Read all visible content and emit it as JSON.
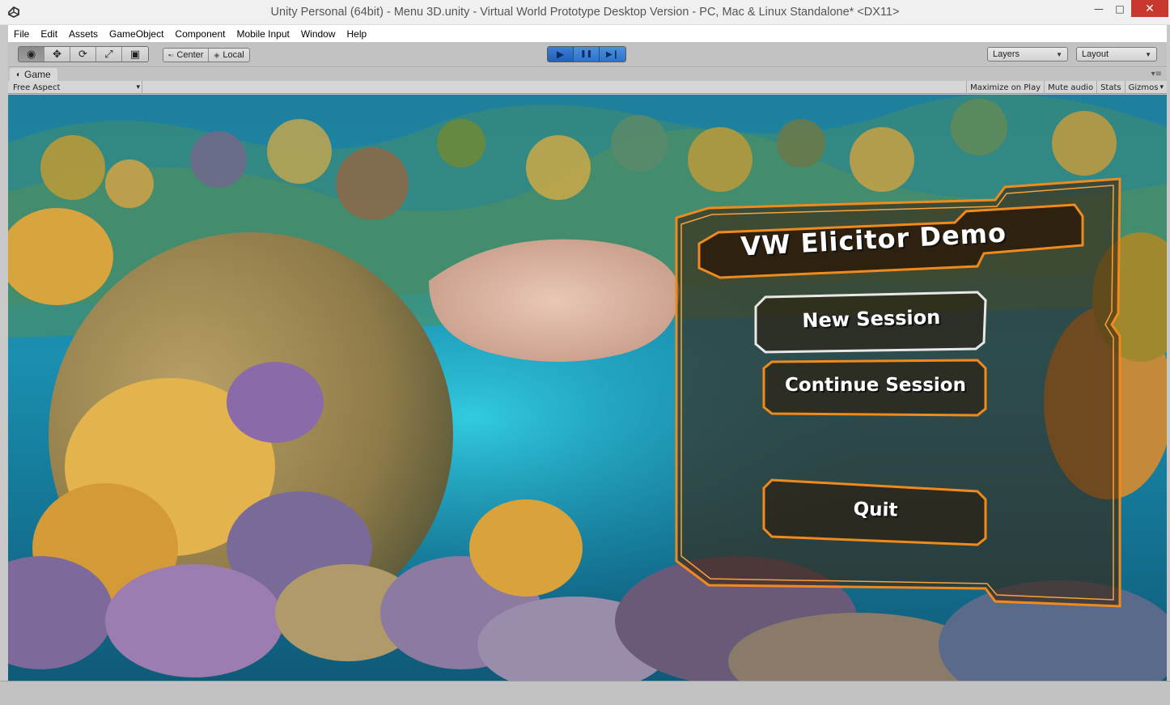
{
  "window": {
    "title": "Unity Personal (64bit) - Menu 3D.unity - Virtual World Prototype Desktop Version - PC, Mac & Linux Standalone* <DX11>",
    "minimize_glyph": "—",
    "maximize_glyph": "□",
    "close_glyph": "✕"
  },
  "menubar": {
    "items": [
      "File",
      "Edit",
      "Assets",
      "GameObject",
      "Component",
      "Mobile Input",
      "Window",
      "Help"
    ]
  },
  "toolbar": {
    "tools": [
      {
        "icon": "eye-icon",
        "glyph": "◉"
      },
      {
        "icon": "move-icon",
        "glyph": "✥"
      },
      {
        "icon": "rotate-icon",
        "glyph": "⟳"
      },
      {
        "icon": "scale-icon",
        "glyph": "⤢"
      },
      {
        "icon": "rect-tool-icon",
        "glyph": "▣"
      }
    ],
    "pivot_label": "Center",
    "rotation_label": "Local",
    "play_glyph": "▶",
    "pause_glyph": "❚❚",
    "step_glyph": "▶❙",
    "layers_label": "Layers",
    "layout_label": "Layout",
    "dropdown_arrow": "▼"
  },
  "game_view": {
    "tab_label": "Game",
    "tab_icon_glyph": "◐",
    "panel_menu_glyph": "▾≡",
    "aspect_label": "Free Aspect",
    "aspect_arrow": "▾",
    "toggles": [
      "Maximize on Play",
      "Mute audio",
      "Stats",
      "Gizmos"
    ],
    "gizmos_arrow": "▾"
  },
  "game_menu": {
    "title": "VW Elicitor Demo",
    "buttons": [
      "New Session",
      "Continue Session",
      "Quit"
    ]
  },
  "colors": {
    "panel_border": "#f08a1c",
    "button_selected_border": "#e8e8e8",
    "play_blue": "#3a7bd5",
    "close_red": "#c7392f"
  }
}
